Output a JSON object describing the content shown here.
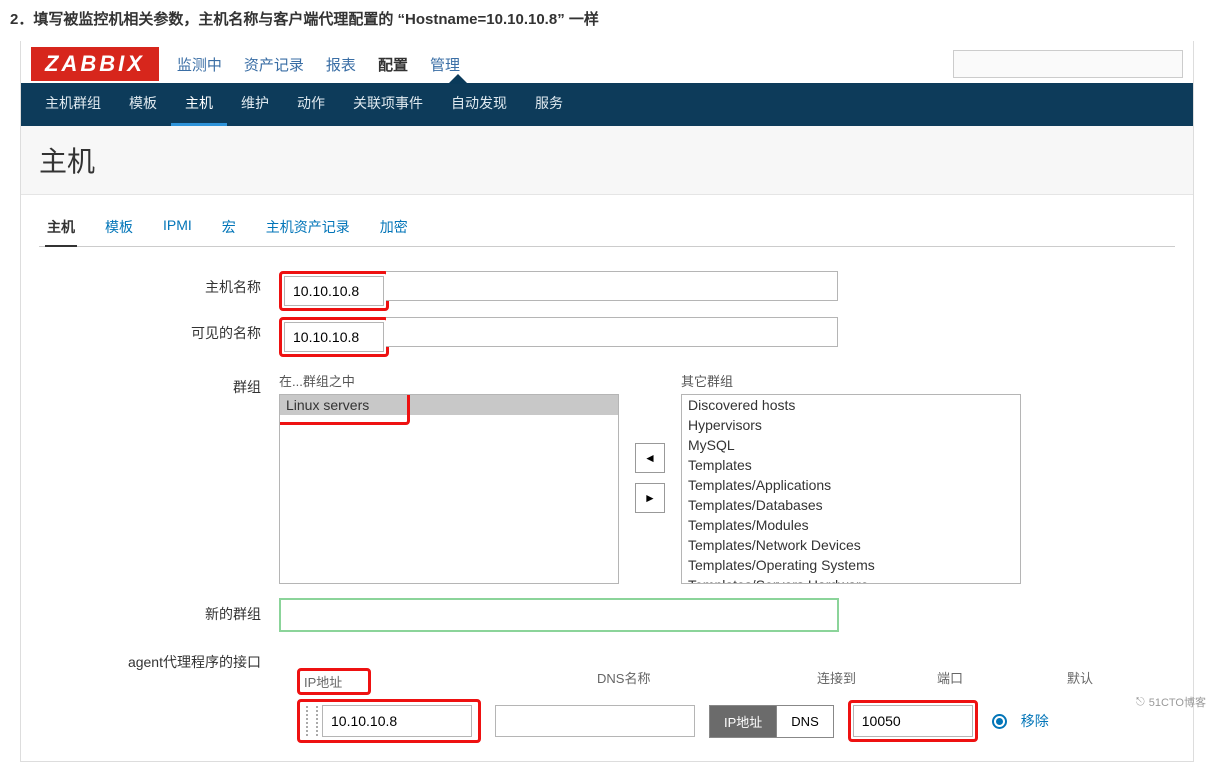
{
  "instruction": "2．填写被监控机相关参数，主机名称与客户端代理配置的 “Hostname=10.10.10.8” 一样",
  "logo": "ZABBIX",
  "topnav": {
    "items": [
      "监测中",
      "资产记录",
      "报表",
      "配置",
      "管理"
    ],
    "active_index": 3
  },
  "subnav": {
    "items": [
      "主机群组",
      "模板",
      "主机",
      "维护",
      "动作",
      "关联项事件",
      "自动发现",
      "服务"
    ],
    "active_index": 2
  },
  "page_title": "主机",
  "tabs": {
    "items": [
      "主机",
      "模板",
      "IPMI",
      "宏",
      "主机资产记录",
      "加密"
    ],
    "active_index": 0
  },
  "form": {
    "labels": {
      "hostname": "主机名称",
      "visible_name": "可见的名称",
      "groups": "群组",
      "in_groups": "在...群组之中",
      "other_groups": "其它群组",
      "new_group": "新的群组",
      "agent_iface": "agent代理程序的接口"
    },
    "hostname": "10.10.10.8",
    "visible_name": "10.10.10.8",
    "in_groups": [
      "Linux servers"
    ],
    "other_groups": [
      "Discovered hosts",
      "Hypervisors",
      "MySQL",
      "Templates",
      "Templates/Applications",
      "Templates/Databases",
      "Templates/Modules",
      "Templates/Network Devices",
      "Templates/Operating Systems",
      "Templates/Servers Hardware"
    ],
    "new_group": "",
    "iface_headers": {
      "ip": "IP地址",
      "dns": "DNS名称",
      "connect": "连接到",
      "port": "端口",
      "default": "默认"
    },
    "iface": {
      "ip": "10.10.10.8",
      "dns": "",
      "connect_options": [
        "IP地址",
        "DNS"
      ],
      "connect_selected": 0,
      "port": "10050",
      "remove_label": "移除"
    }
  },
  "watermark": "51CTO博客"
}
